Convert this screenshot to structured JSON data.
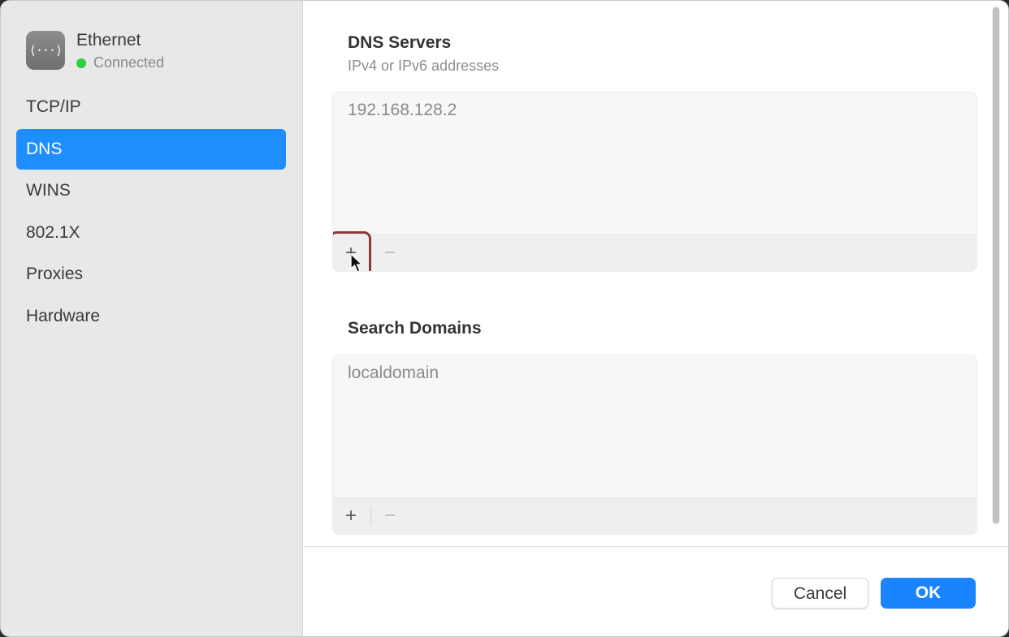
{
  "interface": {
    "name": "Ethernet",
    "status": "Connected",
    "icon": "ethernet-icon",
    "icon_glyph": "⟨···⟩",
    "status_color": "#2ecc40"
  },
  "sidebar": {
    "items": [
      {
        "label": "TCP/IP"
      },
      {
        "label": "DNS",
        "selected": true
      },
      {
        "label": "WINS"
      },
      {
        "label": "802.1X"
      },
      {
        "label": "Proxies"
      },
      {
        "label": "Hardware"
      }
    ]
  },
  "dns_servers": {
    "title": "DNS Servers",
    "subtitle": "IPv4 or IPv6 addresses",
    "entries": [
      "192.168.128.2"
    ],
    "add_label": "+",
    "remove_label": "−"
  },
  "search_domains": {
    "title": "Search Domains",
    "entries": [
      "localdomain"
    ],
    "add_label": "+",
    "remove_label": "−"
  },
  "buttons": {
    "cancel": "Cancel",
    "ok": "OK"
  },
  "colors": {
    "accent": "#1e8eff",
    "ok_button": "#1a84ff",
    "highlight_outline": "#8b3a3a"
  }
}
